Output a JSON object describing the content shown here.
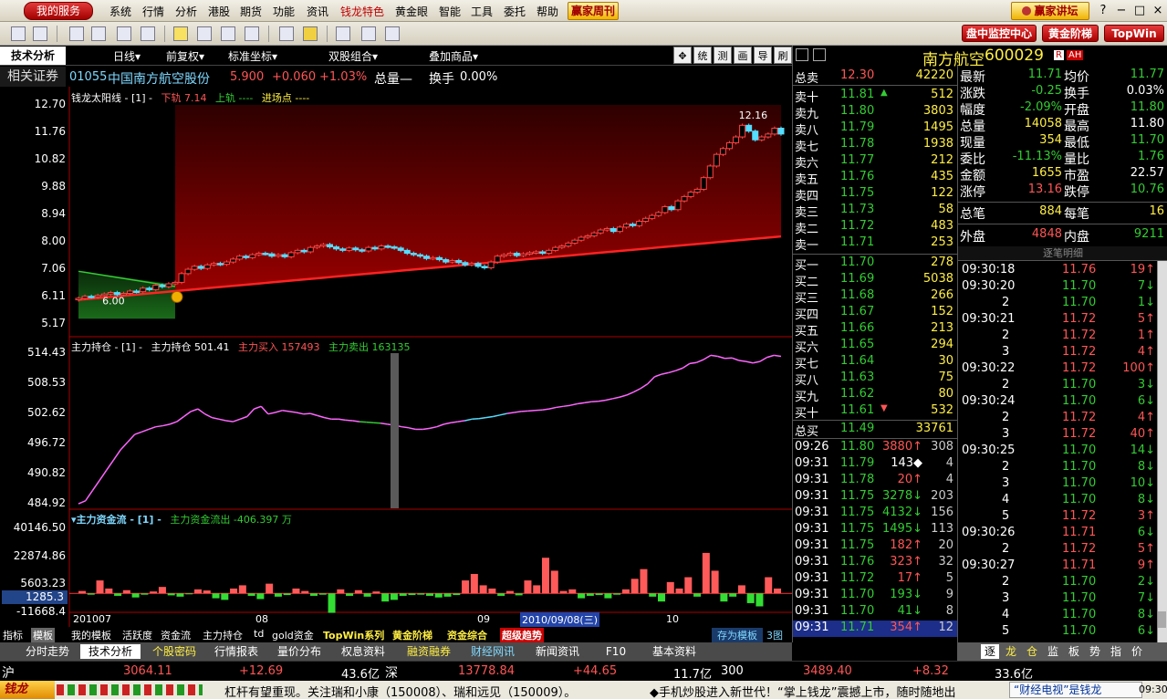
{
  "menubar": {
    "my_service": "我的服务",
    "items": [
      "系统",
      "行情",
      "分析",
      "港股",
      "期货",
      "功能",
      "资讯",
      "钱龙特色",
      "黄金眼",
      "智能",
      "工具",
      "委托",
      "帮助"
    ],
    "highlight_index": 7,
    "weekly": "赢家周刊",
    "forum": "赢家讲坛",
    "help_btn": "?",
    "min_btn": "−",
    "max_btn": "□",
    "close_btn": "×"
  },
  "toolbar": {
    "monitor": "盘中监控中心",
    "gold_ladder": "黄金阶梯",
    "topwin": "TopWin"
  },
  "chart_toolbar": {
    "tab": "技术分析",
    "dropdowns": [
      "日线▾",
      "前复权▾",
      "标准坐标▾",
      "双股组合▾",
      "叠加商品▾"
    ],
    "buttons": [
      "统",
      "测",
      "画",
      "导",
      "刷"
    ]
  },
  "stock_header": {
    "title": "相关证券",
    "code": "01055",
    "name": "中国南方航空股份",
    "price": "5.900",
    "change": "+0.060",
    "pct": "+1.03%",
    "volume_label": "总量—",
    "turnover_label": "换手",
    "turnover": "0.00%"
  },
  "panel1": {
    "title": "钱龙太阳线 - [1] -",
    "lower_label": "下轨",
    "lower_value": "7.14",
    "upper_label": "上轨 ----",
    "entry_label": "进场点 ----",
    "yaxis": [
      "12.70",
      "11.76",
      "10.82",
      "9.88",
      "8.94",
      "8.00",
      "7.06",
      "6.11",
      "5.17"
    ],
    "high_label": "12.16",
    "low_label": "6.00"
  },
  "panel2": {
    "title": "主力持仓 - [1] -",
    "hold_label": "主力持仓",
    "hold_value": "501.41",
    "buy_label": "主力买入",
    "buy_value": "157493",
    "sell_label": "主力卖出",
    "sell_value": "163135",
    "yaxis": [
      "514.43",
      "508.53",
      "502.62",
      "496.72",
      "490.82",
      "484.92"
    ]
  },
  "panel3": {
    "title": "▾主力资金流 - [1] -",
    "flow_label": "主力资金流出",
    "flow_value": "-406.397 万",
    "yaxis": [
      "40146.50",
      "22874.86",
      "5603.23",
      "-11668.4"
    ],
    "cursor_value": "1285.3",
    "xaxis": [
      "201007",
      "08",
      "09",
      "10"
    ],
    "cursor_date": "2010/09/08(三)"
  },
  "indicator_tabs": [
    "指标",
    "模板",
    "我的模板",
    "活跃度",
    "资金流",
    "主力持仓",
    "td",
    "gold资金",
    "TopWin系列",
    "黄金阶梯",
    "资金综合",
    "超级趋势",
    "存为模板",
    "3图"
  ],
  "page_tabs": [
    "分时走势",
    "技术分析",
    "个股密码",
    "行情报表",
    "量价分布",
    "权息资料",
    "融资融券",
    "财经网讯",
    "新闻资讯",
    "F10",
    "基本资料"
  ],
  "quote": {
    "name": "南方航空",
    "code": "600029",
    "badge_r": "R",
    "badge_ah": "AH",
    "fields": [
      {
        "l1": "最新",
        "v1": "11.71",
        "l2": "均价",
        "v2": "11.77"
      },
      {
        "l1": "涨跌",
        "v1": "-0.25",
        "l2": "换手",
        "v2": "0.03%"
      },
      {
        "l1": "幅度",
        "v1": "-2.09%",
        "l2": "开盘",
        "v2": "11.80"
      },
      {
        "l1": "总量",
        "v1": "14058",
        "l2": "最高",
        "v2": "11.80"
      },
      {
        "l1": "现量",
        "v1": "354",
        "l2": "最低",
        "v2": "11.70"
      },
      {
        "l1": "委比",
        "v1": "-11.13%",
        "l2": "量比",
        "v2": "1.76"
      },
      {
        "l1": "金额",
        "v1": "1655",
        "l2": "市盈",
        "v2": "22.57"
      },
      {
        "l1": "涨停",
        "v1": "13.16",
        "l2": "跌停",
        "v2": "10.76"
      }
    ],
    "total_trades_label": "总笔",
    "total_trades": "884",
    "per_trade_label": "每笔",
    "per_trade": "16",
    "outer_label": "外盘",
    "outer": "4848",
    "inner_label": "内盘",
    "inner": "9211"
  },
  "orderbook": {
    "total_sell_label": "总卖",
    "total_sell_price": "12.30",
    "total_sell_vol": "42220",
    "sells": [
      {
        "label": "卖十",
        "price": "11.81",
        "vol": "512"
      },
      {
        "label": "卖九",
        "price": "11.80",
        "vol": "3803"
      },
      {
        "label": "卖八",
        "price": "11.79",
        "vol": "1495"
      },
      {
        "label": "卖七",
        "price": "11.78",
        "vol": "1938"
      },
      {
        "label": "卖六",
        "price": "11.77",
        "vol": "212"
      },
      {
        "label": "卖五",
        "price": "11.76",
        "vol": "435"
      },
      {
        "label": "卖四",
        "price": "11.75",
        "vol": "122"
      },
      {
        "label": "卖三",
        "price": "11.73",
        "vol": "58"
      },
      {
        "label": "卖二",
        "price": "11.72",
        "vol": "483"
      },
      {
        "label": "卖一",
        "price": "11.71",
        "vol": "253"
      }
    ],
    "buys": [
      {
        "label": "买一",
        "price": "11.70",
        "vol": "278"
      },
      {
        "label": "买二",
        "price": "11.69",
        "vol": "5038"
      },
      {
        "label": "买三",
        "price": "11.68",
        "vol": "266"
      },
      {
        "label": "买四",
        "price": "11.67",
        "vol": "152"
      },
      {
        "label": "买五",
        "price": "11.66",
        "vol": "213"
      },
      {
        "label": "买六",
        "price": "11.65",
        "vol": "294"
      },
      {
        "label": "买七",
        "price": "11.64",
        "vol": "30"
      },
      {
        "label": "买八",
        "price": "11.63",
        "vol": "75"
      },
      {
        "label": "买九",
        "price": "11.62",
        "vol": "80"
      },
      {
        "label": "买十",
        "price": "11.61",
        "vol": "532"
      }
    ],
    "total_buy_label": "总买",
    "total_buy_price": "11.49",
    "total_buy_vol": "33761",
    "trades": [
      {
        "time": "09:26",
        "price": "11.80",
        "vol": "3880↑",
        "n": "308"
      },
      {
        "time": "09:31",
        "price": "11.79",
        "vol": "143◆",
        "n": "4"
      },
      {
        "time": "09:31",
        "price": "11.78",
        "vol": "20↑",
        "n": "4"
      },
      {
        "time": "09:31",
        "price": "11.75",
        "vol": "3278↓",
        "n": "203"
      },
      {
        "time": "09:31",
        "price": "11.75",
        "vol": "4132↓",
        "n": "156"
      },
      {
        "time": "09:31",
        "price": "11.75",
        "vol": "1495↓",
        "n": "113"
      },
      {
        "time": "09:31",
        "price": "11.75",
        "vol": "182↑",
        "n": "20"
      },
      {
        "time": "09:31",
        "price": "11.76",
        "vol": "323↑",
        "n": "32"
      },
      {
        "time": "09:31",
        "price": "11.72",
        "vol": "17↑",
        "n": "5"
      },
      {
        "time": "09:31",
        "price": "11.70",
        "vol": "193↓",
        "n": "9"
      },
      {
        "time": "09:31",
        "price": "11.70",
        "vol": "41↓",
        "n": "8"
      },
      {
        "time": "09:31",
        "price": "11.71",
        "vol": "354↑",
        "n": "12"
      }
    ]
  },
  "ticks": {
    "title": "逐笔明细",
    "rows": [
      {
        "time": "09:30:18",
        "price": "11.76",
        "vol": "19↑"
      },
      {
        "time": "09:30:20",
        "price": "11.70",
        "vol": "7↓"
      },
      {
        "time": "2",
        "price": "11.70",
        "vol": "1↓"
      },
      {
        "time": "09:30:21",
        "price": "11.72",
        "vol": "5↑"
      },
      {
        "time": "2",
        "price": "11.72",
        "vol": "1↑"
      },
      {
        "time": "3",
        "price": "11.72",
        "vol": "4↑"
      },
      {
        "time": "09:30:22",
        "price": "11.72",
        "vol": "100↑"
      },
      {
        "time": "2",
        "price": "11.70",
        "vol": "3↓"
      },
      {
        "time": "09:30:24",
        "price": "11.70",
        "vol": "6↓"
      },
      {
        "time": "2",
        "price": "11.72",
        "vol": "4↑"
      },
      {
        "time": "3",
        "price": "11.72",
        "vol": "40↑"
      },
      {
        "time": "09:30:25",
        "price": "11.70",
        "vol": "14↓"
      },
      {
        "time": "2",
        "price": "11.70",
        "vol": "8↓"
      },
      {
        "time": "3",
        "price": "11.70",
        "vol": "10↓"
      },
      {
        "time": "4",
        "price": "11.70",
        "vol": "8↓"
      },
      {
        "time": "5",
        "price": "11.72",
        "vol": "3↑"
      },
      {
        "time": "09:30:26",
        "price": "11.71",
        "vol": "6↓"
      },
      {
        "time": "2",
        "price": "11.72",
        "vol": "5↑"
      },
      {
        "time": "09:30:27",
        "price": "11.71",
        "vol": "9↑"
      },
      {
        "time": "2",
        "price": "11.70",
        "vol": "2↓"
      },
      {
        "time": "3",
        "price": "11.70",
        "vol": "7↓"
      },
      {
        "time": "4",
        "price": "11.70",
        "vol": "8↓"
      },
      {
        "time": "5",
        "price": "11.70",
        "vol": "6↓"
      }
    ],
    "tabs": [
      "逐",
      "龙",
      "仓",
      "监",
      "板",
      "势",
      "指",
      "价"
    ]
  },
  "indexbar": {
    "sh_label": "沪",
    "sh_value": "3064.11",
    "sh_change": "+12.69",
    "sh_amount": "43.6亿",
    "sz_label": "深",
    "sz_value": "13778.84",
    "sz_change": "+44.65",
    "sz_amount": "11.7亿",
    "hs300_label": "300",
    "hs300_value": "3489.40",
    "hs300_change": "+8.32",
    "hs300_amount": "33.6亿"
  },
  "tickerbar": {
    "logo": "钱龙",
    "text1": "杠杆有望重现。关注瑞和小康（150008）、瑞和远见（150009）。",
    "text2": "◆手机炒股进入新世代！“掌上钱龙”震撼上市，随时随地出",
    "text3": "“财经电视”是钱龙",
    "clock": "09:30"
  },
  "chart_data": [
    {
      "type": "candlestick",
      "name": "钱龙太阳线",
      "ylim": [
        5.17,
        12.7
      ],
      "yticks": [
        12.7,
        11.76,
        10.82,
        9.88,
        8.94,
        8.0,
        7.06,
        6.11,
        5.17
      ],
      "close": [
        6.05,
        6.12,
        6.1,
        6.15,
        6.2,
        6.25,
        6.18,
        6.22,
        6.3,
        6.28,
        6.4,
        6.35,
        6.5,
        6.45,
        6.55,
        6.6,
        6.9,
        7.05,
        7.15,
        7.08,
        7.2,
        7.25,
        7.22,
        7.3,
        7.4,
        7.5,
        7.45,
        7.55,
        7.6,
        7.58,
        7.5,
        7.55,
        7.48,
        7.62,
        7.7,
        7.65,
        7.8,
        7.85,
        7.9,
        7.82,
        7.75,
        7.7,
        7.78,
        7.72,
        7.68,
        7.8,
        7.75,
        7.85,
        7.82,
        7.78,
        7.7,
        7.6,
        7.55,
        7.5,
        7.42,
        7.45,
        7.38,
        7.3,
        7.35,
        7.28,
        7.2,
        7.25,
        7.15,
        7.1,
        7.3,
        7.5,
        7.55,
        7.6,
        7.52,
        7.58,
        7.62,
        7.65,
        7.6,
        7.7,
        7.8,
        7.85,
        7.95,
        8.05,
        8.15,
        8.2,
        8.3,
        8.4,
        8.45,
        8.35,
        8.5,
        8.6,
        8.55,
        8.7,
        8.8,
        8.9,
        9.0,
        9.2,
        9.1,
        9.4,
        9.55,
        9.7,
        9.8,
        10.2,
        10.6,
        11.0,
        11.2,
        11.4,
        11.6,
        12.0,
        11.8,
        11.5,
        11.6,
        11.7,
        11.9,
        11.7
      ],
      "lower": [
        6.0,
        6.02,
        6.04,
        6.06,
        6.08,
        6.1,
        6.12,
        6.14,
        6.16,
        6.18,
        6.2,
        6.22,
        6.24,
        6.26,
        6.28,
        6.3,
        6.32,
        6.34,
        6.36,
        6.38,
        6.4,
        6.42,
        6.44,
        6.46,
        6.48,
        6.5,
        6.52,
        6.54,
        6.56,
        6.58,
        6.6,
        6.62,
        6.64,
        6.66,
        6.68,
        6.7,
        6.72,
        6.74,
        6.76,
        6.78,
        6.8,
        6.82,
        6.84,
        6.86,
        6.88,
        6.9,
        6.92,
        6.94,
        6.96,
        6.98,
        7.0,
        7.02,
        7.04,
        7.06,
        7.08,
        7.1,
        7.12,
        7.14,
        7.16,
        7.18,
        7.2,
        7.22,
        7.24,
        7.26,
        7.28,
        7.3,
        7.32,
        7.34,
        7.36,
        7.38,
        7.4,
        7.42,
        7.44,
        7.46,
        7.48,
        7.5,
        7.52,
        7.54,
        7.56,
        7.58,
        7.6,
        7.62,
        7.64,
        7.66,
        7.68,
        7.7,
        7.72,
        7.74,
        7.76,
        7.78,
        7.8,
        7.82,
        7.84,
        7.86,
        7.88,
        7.9,
        7.92,
        7.94,
        7.96,
        7.98,
        8.0,
        8.02,
        8.04,
        8.06,
        8.08,
        8.1,
        8.12,
        8.14,
        8.16,
        8.18
      ]
    },
    {
      "type": "line",
      "name": "主力持仓",
      "ylim": [
        484.92,
        514.43
      ],
      "yticks": [
        514.43,
        508.53,
        502.62,
        496.72,
        490.82,
        484.92
      ],
      "values": [
        484.9,
        485.5,
        487.5,
        489.5,
        491.5,
        493.5,
        495.5,
        497,
        498.5,
        499,
        499.5,
        500,
        500.2,
        500.5,
        501,
        502,
        503,
        503.5,
        502.5,
        501.8,
        501.5,
        501.2,
        501,
        501.5,
        502,
        503.5,
        504,
        502.5,
        502.8,
        503.2,
        503,
        502.8,
        502.5,
        502.6,
        502.2,
        501.8,
        501.5,
        501.5,
        501.3,
        501.2,
        501,
        500.9,
        500.8,
        500.7,
        500.5,
        500.3,
        500,
        499.8,
        499.5,
        499.5,
        499.7,
        500,
        500.5,
        500.8,
        501,
        501.2,
        501.5,
        501.6,
        501.8,
        502,
        502.3,
        502.6,
        502.8,
        503,
        503.1,
        503.2,
        503.3,
        503.5,
        503.8,
        504,
        504.2,
        504.5,
        504.7,
        504.9,
        505,
        505.2,
        505.5,
        505.8,
        506.2,
        506.8,
        507.5,
        508.4,
        509.8,
        510.3,
        510.6,
        511,
        511.5,
        512.4,
        512.6,
        513.2,
        514,
        513.8,
        513.4,
        513.5,
        513,
        512.8,
        512.5,
        512.8,
        513.6,
        514,
        513.8
      ]
    },
    {
      "type": "bar",
      "name": "主力资金流",
      "ylim": [
        -11668.4,
        40146.5
      ],
      "yticks": [
        40146.5,
        22874.86,
        5603.23,
        -11668.4
      ],
      "values": [
        1500,
        -800,
        8000,
        3000,
        -1500,
        2000,
        -2500,
        -800,
        1200,
        4000,
        -1200,
        -2000,
        -500,
        2500,
        1800,
        -3000,
        -4000,
        3000,
        5000,
        -1500,
        -3500,
        6000,
        -2000,
        -1000,
        3000,
        1500,
        -1500,
        -800,
        -12000,
        2500,
        -1500,
        2000,
        -2000,
        1200,
        -5000,
        -4000,
        -1500,
        -1000,
        -800,
        -1500,
        -2500,
        -2000,
        -1000,
        8000,
        12000,
        5000,
        3000,
        -1500,
        1500,
        -1200,
        8000,
        5000,
        22000,
        14000,
        1500,
        2500,
        -3000,
        -1500,
        -1000,
        -3000,
        -800,
        2500,
        9000,
        15000,
        -2000,
        -5000,
        7000,
        3000,
        10000,
        -2000,
        25000,
        14000,
        -5000,
        -2000,
        5000,
        -6000,
        -8000,
        10000,
        3000
      ]
    }
  ]
}
